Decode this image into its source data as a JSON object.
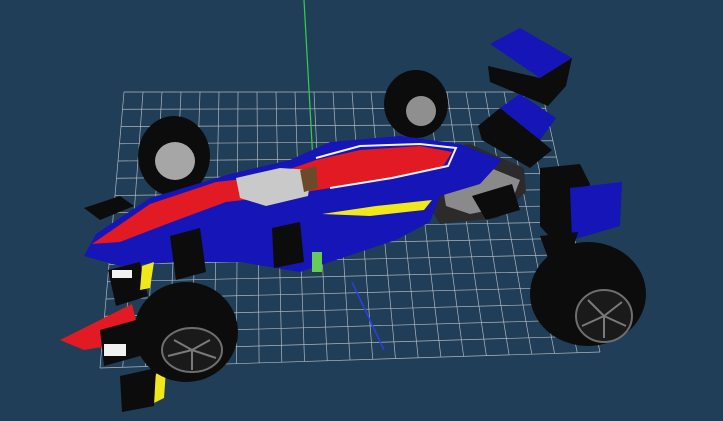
{
  "viewport": {
    "background_color": "#203e58",
    "grid_color": "#c8ccd0",
    "axis_colors": {
      "x": "#2a3fe0",
      "y": "#34d04a"
    }
  },
  "car": {
    "livery_colors": {
      "primary_blue": "#1515b8",
      "accent_red": "#e21a24",
      "stripe_white": "#f2f2f2",
      "stripe_yellow": "#f0e81a",
      "cockpit_grey": "#c9c9c9",
      "tyre_black": "#0c0c0c",
      "wheel_hub_grey": "#9a9a9a"
    }
  }
}
